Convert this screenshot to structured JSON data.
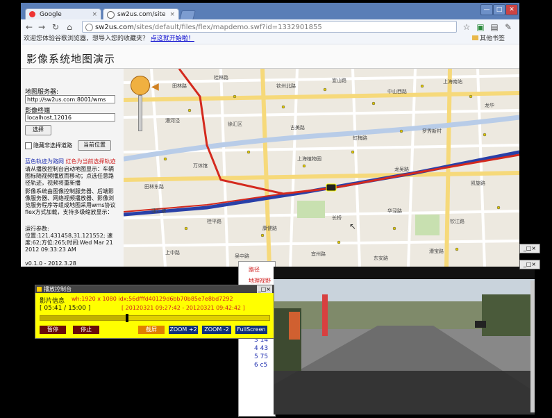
{
  "browser": {
    "tabs": [
      {
        "label": "Google"
      },
      {
        "label": "sw2us.com/sites/default/"
      }
    ],
    "window_buttons": [
      "—",
      "□",
      "✕"
    ],
    "address": {
      "host": "sw2us.com",
      "path": "/sites/default/files/flex/mapdemo.swf?id=1332901855"
    },
    "infobar": {
      "text": "欢迎您体验谷歌浏览器，想导入您的收藏夹？",
      "link": "点这就开始啦！",
      "other_bookmarks": "其他书签"
    }
  },
  "page": {
    "title": "影像系统地图演示"
  },
  "sidebar": {
    "map_server_label": "地图服务器:",
    "map_server_value": "http://sw2us.com:8001/wms",
    "video_terminal_label": "影像终端",
    "video_terminal_value": "localhost,12016",
    "select_button": "选择",
    "hide_checkbox_label": "隐藏非选择道路",
    "current_location_button": "当前位置",
    "legend_blue": "蓝色轨迹为路网",
    "legend_red": "红色为当前选择轨迹",
    "help_1": "请从播放控制台启动地图显示：车辆图标随视频播放而移动；点选任意路径轨迹，视频将重新播",
    "help_2": "影像系统由图像控制服务器、后端影像服务器、网络视频播放器、影像浏览服务程序等组成地图采用wms协议flex方式加载，支持多级缩放显示：",
    "params_label": "运行参数:",
    "params_value": "位置:121.431458,31.121552; 速度:62;方位:265;时间:Wed Mar 21 2012 09:33:23 AM",
    "version": "v0.1.0 - 2012.3.28"
  },
  "map": {
    "labels": [
      "田林路",
      "桂林路",
      "钦州北路",
      "宜山路",
      "中山西路",
      "上海南站",
      "龙华",
      "漕河泾",
      "徐汇区",
      "古美路",
      "虹梅路",
      "罗秀新村",
      "田林东路",
      "万体馆",
      "上海植物园",
      "龙吴路",
      "凯旋路",
      "蒲汇塘",
      "桂平路",
      "康健路",
      "长桥",
      "华泾路",
      "钦江路",
      "上中路",
      "吴中路",
      "宜州路",
      "东安路",
      "漕宝路"
    ]
  },
  "control": {
    "window_title": "播放控制台",
    "info_label": "影片信息",
    "info_value": "wh:1920 x 1080 idx:56dfffd40129d6bb70b85e7e8bd7292",
    "time_value": "[ 05:41 / 15:00 ]",
    "range_value": "[ 20120321 09:27:42 - 20120321 09:42:42 ]",
    "buttons": [
      "暂停",
      "停止",
      "截屏",
      "ZOOM +2",
      "ZOOM -2",
      "FullScreen"
    ],
    "progress": 0.38
  },
  "list": {
    "items": [
      "3 14",
      "4 43",
      "5 75",
      "6 c5"
    ],
    "top_labels": [
      "路径",
      "地理视野"
    ]
  },
  "colors": {
    "route_red": "#d42a1e",
    "route_blue": "#2940a8",
    "road_yellow": "#f6d97a",
    "control_bg": "#ffff00",
    "btn_dark_red": "#6a0a0a",
    "btn_orange": "#e08000",
    "btn_navy": "#10307a"
  }
}
